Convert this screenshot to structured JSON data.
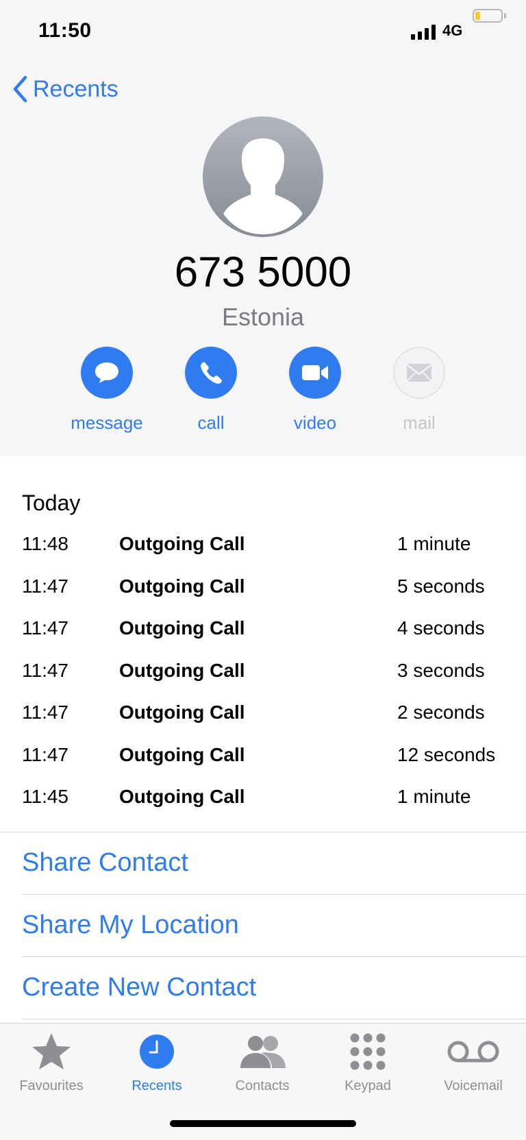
{
  "status_bar": {
    "time": "11:50",
    "network": "4G"
  },
  "nav": {
    "back_label": "Recents"
  },
  "contact": {
    "number": "673 5000",
    "country": "Estonia"
  },
  "actions": [
    {
      "label": "message",
      "icon": "message-icon",
      "enabled": true
    },
    {
      "label": "call",
      "icon": "phone-icon",
      "enabled": true
    },
    {
      "label": "video",
      "icon": "video-icon",
      "enabled": true
    },
    {
      "label": "mail",
      "icon": "mail-icon",
      "enabled": false
    }
  ],
  "history": {
    "section": "Today",
    "calls": [
      {
        "time": "11:48",
        "kind": "Outgoing Call",
        "duration": "1 minute"
      },
      {
        "time": "11:47",
        "kind": "Outgoing Call",
        "duration": "5 seconds"
      },
      {
        "time": "11:47",
        "kind": "Outgoing Call",
        "duration": "4 seconds"
      },
      {
        "time": "11:47",
        "kind": "Outgoing Call",
        "duration": "3 seconds"
      },
      {
        "time": "11:47",
        "kind": "Outgoing Call",
        "duration": "2 seconds"
      },
      {
        "time": "11:47",
        "kind": "Outgoing Call",
        "duration": "12 seconds"
      },
      {
        "time": "11:45",
        "kind": "Outgoing Call",
        "duration": "1 minute"
      }
    ]
  },
  "links": {
    "share_contact": "Share Contact",
    "share_location": "Share My Location",
    "create_contact": "Create New Contact"
  },
  "tabs": [
    {
      "label": "Favourites",
      "icon": "star-icon",
      "active": false
    },
    {
      "label": "Recents",
      "icon": "clock-icon",
      "active": true
    },
    {
      "label": "Contacts",
      "icon": "contacts-icon",
      "active": false
    },
    {
      "label": "Keypad",
      "icon": "keypad-icon",
      "active": false
    },
    {
      "label": "Voicemail",
      "icon": "voicemail-icon",
      "active": false
    }
  ],
  "colors": {
    "accent": "#2f7cf0",
    "battery": "#f2cc2b",
    "muted": "#8e8e93"
  },
  "battery_level": 0.2
}
